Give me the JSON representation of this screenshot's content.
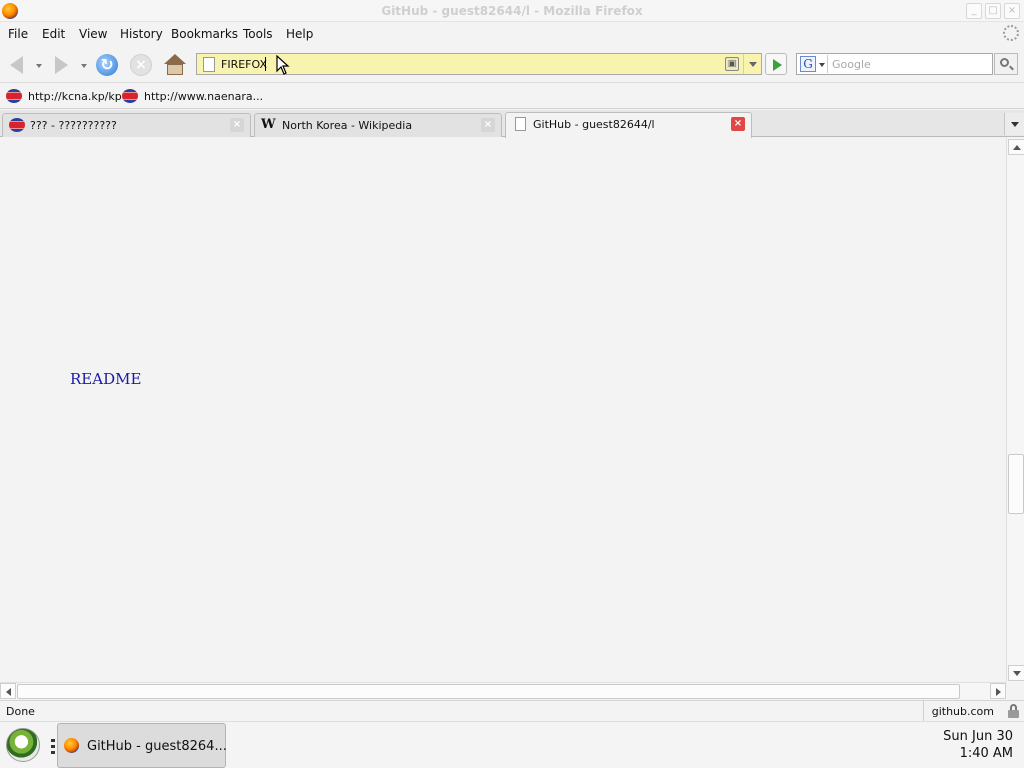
{
  "window": {
    "title": "GitHub - guest82644/l - Mozilla Firefox",
    "buttons": [
      "_",
      "□",
      "×"
    ]
  },
  "menubar": {
    "items": [
      "File",
      "Edit",
      "View",
      "History",
      "Bookmarks",
      "Tools",
      "Help"
    ]
  },
  "navbar": {
    "url_value": "FIREFOX",
    "search_placeholder": "Google",
    "search_engine_letter": "G"
  },
  "bookmarks": {
    "items": [
      {
        "label": "http://kcna.kp/kp",
        "icon": "kp-flag-icon"
      },
      {
        "label": "http://www.naenara...",
        "icon": "kp-flag-icon"
      }
    ]
  },
  "tabs": [
    {
      "label": "??? - ??????????",
      "icon": "kp-flag-icon",
      "active": false
    },
    {
      "label": "North Korea - Wikipedia",
      "icon": "wikipedia-icon",
      "active": false
    },
    {
      "label": "GitHub - guest82644/l",
      "icon": "page-icon",
      "active": true
    }
  ],
  "content": {
    "link_text": "README",
    "link_color": "#1a1aa6"
  },
  "statusbar": {
    "status": "Done",
    "domain": "github.com"
  },
  "taskbar": {
    "task_label": "GitHub - guest8264...",
    "clock_date": "Sun Jun 30",
    "clock_time": "1:40 AM"
  },
  "colors": {
    "urlbar_bg": "#f9f3b0",
    "active_tab_close": "#e04848"
  }
}
